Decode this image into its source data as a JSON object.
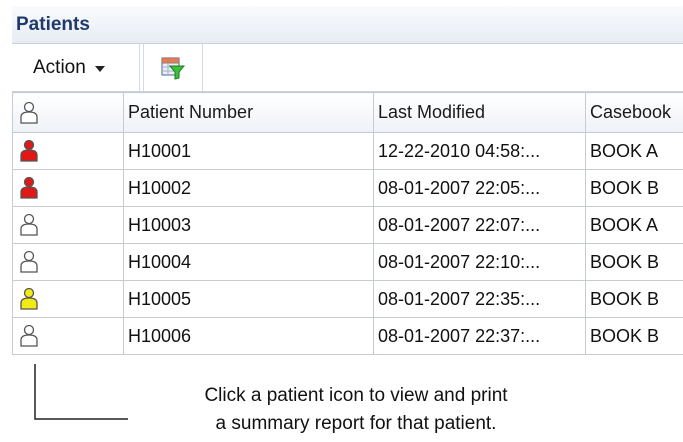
{
  "panel": {
    "title": "Patients"
  },
  "toolbar": {
    "action_label": "Action",
    "filter_icon": "filter-icon"
  },
  "table": {
    "columns": {
      "icon": "patient-icon",
      "patient_number": "Patient Number",
      "last_modified": "Last Modified",
      "casebook": "Casebook"
    },
    "rows": [
      {
        "icon_color": "#e01818",
        "patient_number": "H10001",
        "last_modified": "12-22-2010 04:58:...",
        "casebook": "BOOK A"
      },
      {
        "icon_color": "#e01818",
        "patient_number": "H10002",
        "last_modified": "08-01-2007 22:05:...",
        "casebook": "BOOK B"
      },
      {
        "icon_color": "#ffffff",
        "patient_number": "H10003",
        "last_modified": "08-01-2007 22:07:...",
        "casebook": "BOOK A"
      },
      {
        "icon_color": "#ffffff",
        "patient_number": "H10004",
        "last_modified": "08-01-2007 22:10:...",
        "casebook": "BOOK B"
      },
      {
        "icon_color": "#f2ea14",
        "patient_number": "H10005",
        "last_modified": "08-01-2007 22:35:...",
        "casebook": "BOOK B"
      },
      {
        "icon_color": "#ffffff",
        "patient_number": "H10006",
        "last_modified": "08-01-2007 22:37:...",
        "casebook": "BOOK B"
      }
    ]
  },
  "annotation": {
    "line1": "Click a patient icon to view and print",
    "line2": "a summary report for that patient."
  }
}
